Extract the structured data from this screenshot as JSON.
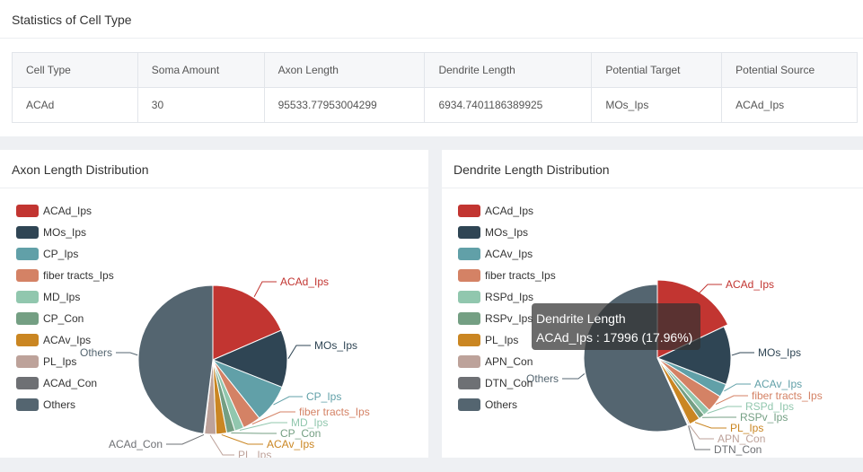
{
  "top": {
    "title": "Statistics of Cell Type",
    "columns": [
      "Cell Type",
      "Soma Amount",
      "Axon Length",
      "Dendrite Length",
      "Potential Target",
      "Potential Source"
    ],
    "row": [
      "ACAd",
      "30",
      "95533.77953004299",
      "6934.7401186389925",
      "MOs_Ips",
      "ACAd_Ips"
    ]
  },
  "axon_panel": {
    "title": "Axon Length Distribution",
    "legend": [
      {
        "label": "ACAd_Ips",
        "color": "#c23531"
      },
      {
        "label": "MOs_Ips",
        "color": "#2f4554"
      },
      {
        "label": "CP_Ips",
        "color": "#61a0a8"
      },
      {
        "label": "fiber tracts_Ips",
        "color": "#d48265"
      },
      {
        "label": "MD_Ips",
        "color": "#91c7ae"
      },
      {
        "label": "CP_Con",
        "color": "#749f83"
      },
      {
        "label": "ACAv_Ips",
        "color": "#ca8622"
      },
      {
        "label": "PL_Ips",
        "color": "#bda29a"
      },
      {
        "label": "ACAd_Con",
        "color": "#6e7074"
      },
      {
        "label": "Others",
        "color": "#546570"
      }
    ]
  },
  "dendrite_panel": {
    "title": "Dendrite Length Distribution",
    "legend": [
      {
        "label": "ACAd_Ips",
        "color": "#c23531"
      },
      {
        "label": "MOs_Ips",
        "color": "#2f4554"
      },
      {
        "label": "ACAv_Ips",
        "color": "#61a0a8"
      },
      {
        "label": "fiber tracts_Ips",
        "color": "#d48265"
      },
      {
        "label": "RSPd_Ips",
        "color": "#91c7ae"
      },
      {
        "label": "RSPv_Ips",
        "color": "#749f83"
      },
      {
        "label": "PL_Ips",
        "color": "#ca8622"
      },
      {
        "label": "APN_Con",
        "color": "#bda29a"
      },
      {
        "label": "DTN_Con",
        "color": "#6e7074"
      },
      {
        "label": "Others",
        "color": "#546570"
      }
    ],
    "tooltip": {
      "title": "Dendrite Length",
      "text": "ACAd_Ips : 17996 (17.96%)"
    }
  },
  "chart_data": [
    {
      "type": "pie",
      "title": "Axon Length Distribution",
      "categories": [
        "ACAd_Ips",
        "MOs_Ips",
        "CP_Ips",
        "fiber tracts_Ips",
        "MD_Ips",
        "CP_Con",
        "ACAv_Ips",
        "PL_Ips",
        "ACAd_Con",
        "Others"
      ],
      "values": [
        18.5,
        12.5,
        8.3,
        3.9,
        2.0,
        1.8,
        2.3,
        2.5,
        0.2,
        48.0
      ],
      "colors": [
        "#c23531",
        "#2f4554",
        "#61a0a8",
        "#d48265",
        "#91c7ae",
        "#749f83",
        "#ca8622",
        "#bda29a",
        "#6e7074",
        "#546570"
      ],
      "legend_position": "left"
    },
    {
      "type": "pie",
      "title": "Dendrite Length Distribution",
      "categories": [
        "ACAd_Ips",
        "MOs_Ips",
        "ACAv_Ips",
        "fiber tracts_Ips",
        "RSPd_Ips",
        "RSPv_Ips",
        "PL_Ips",
        "APN_Con",
        "DTN_Con",
        "Others"
      ],
      "values": [
        17.96,
        12.9,
        2.9,
        3.8,
        1.5,
        1.3,
        2.4,
        0.3,
        0.2,
        56.74
      ],
      "colors": [
        "#c23531",
        "#2f4554",
        "#61a0a8",
        "#d48265",
        "#91c7ae",
        "#749f83",
        "#ca8622",
        "#bda29a",
        "#6e7074",
        "#546570"
      ],
      "legend_position": "left"
    }
  ]
}
